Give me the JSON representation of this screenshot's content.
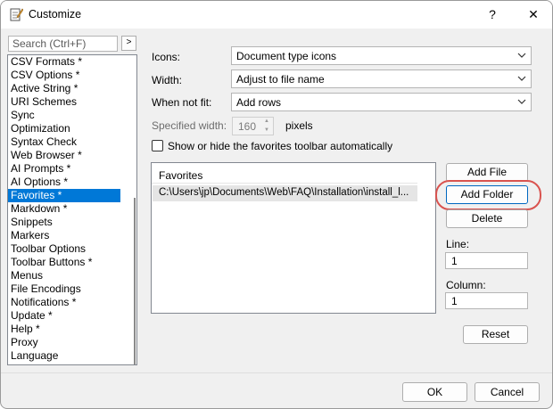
{
  "window": {
    "title": "Customize",
    "help_glyph": "?",
    "close_glyph": "✕"
  },
  "search": {
    "placeholder": "Search (Ctrl+F)",
    "go_glyph": ">"
  },
  "categories": [
    {
      "label": "CSV Formats *"
    },
    {
      "label": "CSV Options *"
    },
    {
      "label": "Active String *"
    },
    {
      "label": "URI Schemes"
    },
    {
      "label": "Sync"
    },
    {
      "label": "Optimization"
    },
    {
      "label": "Syntax Check"
    },
    {
      "label": "Web Browser *"
    },
    {
      "label": "AI Prompts *"
    },
    {
      "label": "AI Options *"
    },
    {
      "label": "Favorites *",
      "selected": true
    },
    {
      "label": "Markdown *"
    },
    {
      "label": "Snippets"
    },
    {
      "label": "Markers"
    },
    {
      "label": "Toolbar Options"
    },
    {
      "label": "Toolbar Buttons *"
    },
    {
      "label": "Menus"
    },
    {
      "label": "File Encodings"
    },
    {
      "label": "Notifications *"
    },
    {
      "label": "Update *"
    },
    {
      "label": "Help *"
    },
    {
      "label": "Proxy"
    },
    {
      "label": "Language"
    }
  ],
  "settings": {
    "icons_label": "Icons:",
    "icons_value": "Document type icons",
    "width_label": "Width:",
    "width_value": "Adjust to file name",
    "notfit_label": "When not fit:",
    "notfit_value": "Add rows",
    "specified_width_label": "Specified width:",
    "specified_width_value": "160",
    "specified_width_unit": "pixels",
    "show_toolbar_label": "Show or hide the favorites toolbar automatically",
    "show_toolbar_checked": false
  },
  "favorites": {
    "header": "Favorites",
    "rows": [
      "C:\\Users\\jp\\Documents\\Web\\FAQ\\Installation\\install_l..."
    ]
  },
  "buttons": {
    "add_file": "Add File",
    "add_folder": "Add Folder",
    "delete": "Delete",
    "reset": "Reset",
    "ok": "OK",
    "cancel": "Cancel"
  },
  "line": {
    "label": "Line:",
    "value": "1"
  },
  "column": {
    "label": "Column:",
    "value": "1"
  },
  "colors": {
    "selection": "#0078d7",
    "focus_border": "#0067c0",
    "annotation": "#d9534f"
  }
}
